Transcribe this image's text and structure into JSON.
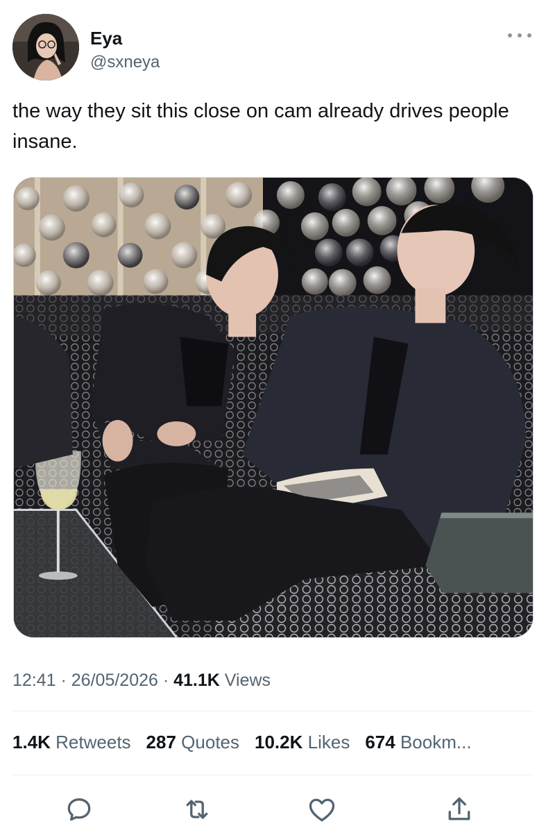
{
  "author": {
    "name": "Eya",
    "handle": "@sxneya"
  },
  "tweet": {
    "text": "the way they sit this close on cam already drives people insane."
  },
  "meta": {
    "time": "12:41",
    "separator": " · ",
    "date": "26/05/2026",
    "views_count": "41.1K",
    "views_label": "Views"
  },
  "stats": {
    "retweets_count": "1.4K",
    "retweets_label": "Retweets",
    "quotes_count": "287",
    "quotes_label": "Quotes",
    "likes_count": "10.2K",
    "likes_label": "Likes",
    "bookmarks_count": "674",
    "bookmarks_label": "Bookm..."
  },
  "icons": {
    "more": "more-horizontal-icon",
    "reply": "reply-icon",
    "retweet": "retweet-icon",
    "like": "heart-icon",
    "share": "share-icon"
  },
  "colors": {
    "text_primary": "#0f1419",
    "text_secondary": "#536471",
    "icon": "#536471"
  }
}
